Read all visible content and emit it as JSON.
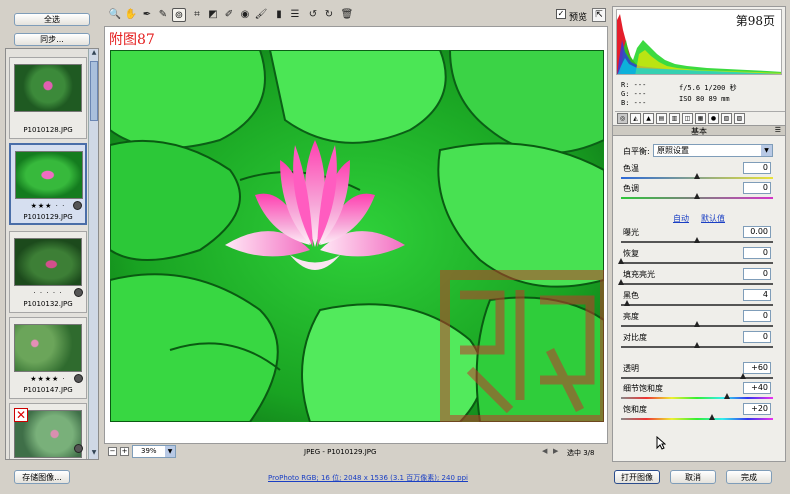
{
  "left_panel": {
    "select_all_label": "全选",
    "sync_label": "同步...",
    "thumbnails": [
      {
        "name": "P1010128.JPG",
        "stars": "",
        "selected": false
      },
      {
        "name": "P1010129.JPG",
        "stars": "★★★ · ·",
        "selected": true
      },
      {
        "name": "P1010132.JPG",
        "stars": "· · · · ·",
        "selected": false
      },
      {
        "name": "P1010147.JPG",
        "stars": "★★★★ ·",
        "selected": false
      },
      {
        "name": "",
        "stars": "",
        "selected": false
      }
    ]
  },
  "toolbar": {
    "tools": [
      "zoom-tool-icon",
      "hand-tool-icon",
      "white-balance-tool-icon",
      "color-sampler-icon",
      "target-adjust-icon",
      "crop-icon",
      "straighten-icon",
      "spot-removal-icon",
      "red-eye-icon",
      "brush-icon",
      "graduated-filter-icon",
      "preferences-icon",
      "rotate-ccw-icon",
      "rotate-cw-icon",
      "trash-icon"
    ],
    "preview_label": "预览",
    "preview_checked": true
  },
  "canvas": {
    "caption": "附图87",
    "zoom_value": "39%",
    "file_info": "JPEG - P1010129.JPG",
    "selection_count": "选中 3/8"
  },
  "histogram": {
    "page_label": "第98页",
    "r_label": "R:",
    "g_label": "G:",
    "b_label": "B:",
    "r_value": "---",
    "g_value": "---",
    "b_value": "---",
    "aperture_shutter": "f/5.6   1/200 秒",
    "iso_focal": "ISO 80   89 mm"
  },
  "basic_panel": {
    "section_title": "基本",
    "white_balance_label": "白平衡:",
    "white_balance_value": "原照设置",
    "auto_link": "自动",
    "default_link": "默认值",
    "params": [
      {
        "key": "temperature",
        "label": "色温",
        "value": "0",
        "level": 0.5
      },
      {
        "key": "tint",
        "label": "色调",
        "value": "0",
        "level": 0.5
      },
      {
        "key": "exposure",
        "label": "曝光",
        "value": "0.00",
        "level": 0.5
      },
      {
        "key": "recovery",
        "label": "恢复",
        "value": "0",
        "level": 0.0
      },
      {
        "key": "fill_light",
        "label": "填充亮光",
        "value": "0",
        "level": 0.0
      },
      {
        "key": "blacks",
        "label": "黑色",
        "value": "4",
        "level": 0.04
      },
      {
        "key": "brightness",
        "label": "亮度",
        "value": "0",
        "level": 0.5
      },
      {
        "key": "contrast",
        "label": "对比度",
        "value": "0",
        "level": 0.5
      },
      {
        "key": "clarity",
        "label": "透明",
        "value": "+60",
        "level": 0.8
      },
      {
        "key": "vibrance",
        "label": "细节饱和度",
        "value": "+40",
        "level": 0.7
      },
      {
        "key": "saturation",
        "label": "饱和度",
        "value": "+20",
        "level": 0.6
      }
    ]
  },
  "footer": {
    "save_label": "存储图像...",
    "workflow_link": "ProPhoto RGB; 16 位; 2048 x 1536 (3.1 百万像素); 240 ppi",
    "open_label": "打开图像",
    "cancel_label": "取消",
    "done_label": "完成"
  },
  "colors": {
    "selected_border": "#4a6ea8",
    "caption_red": "#e41e1e",
    "link_blue": "#1a3fc4",
    "seal_red": "#c0392b"
  }
}
